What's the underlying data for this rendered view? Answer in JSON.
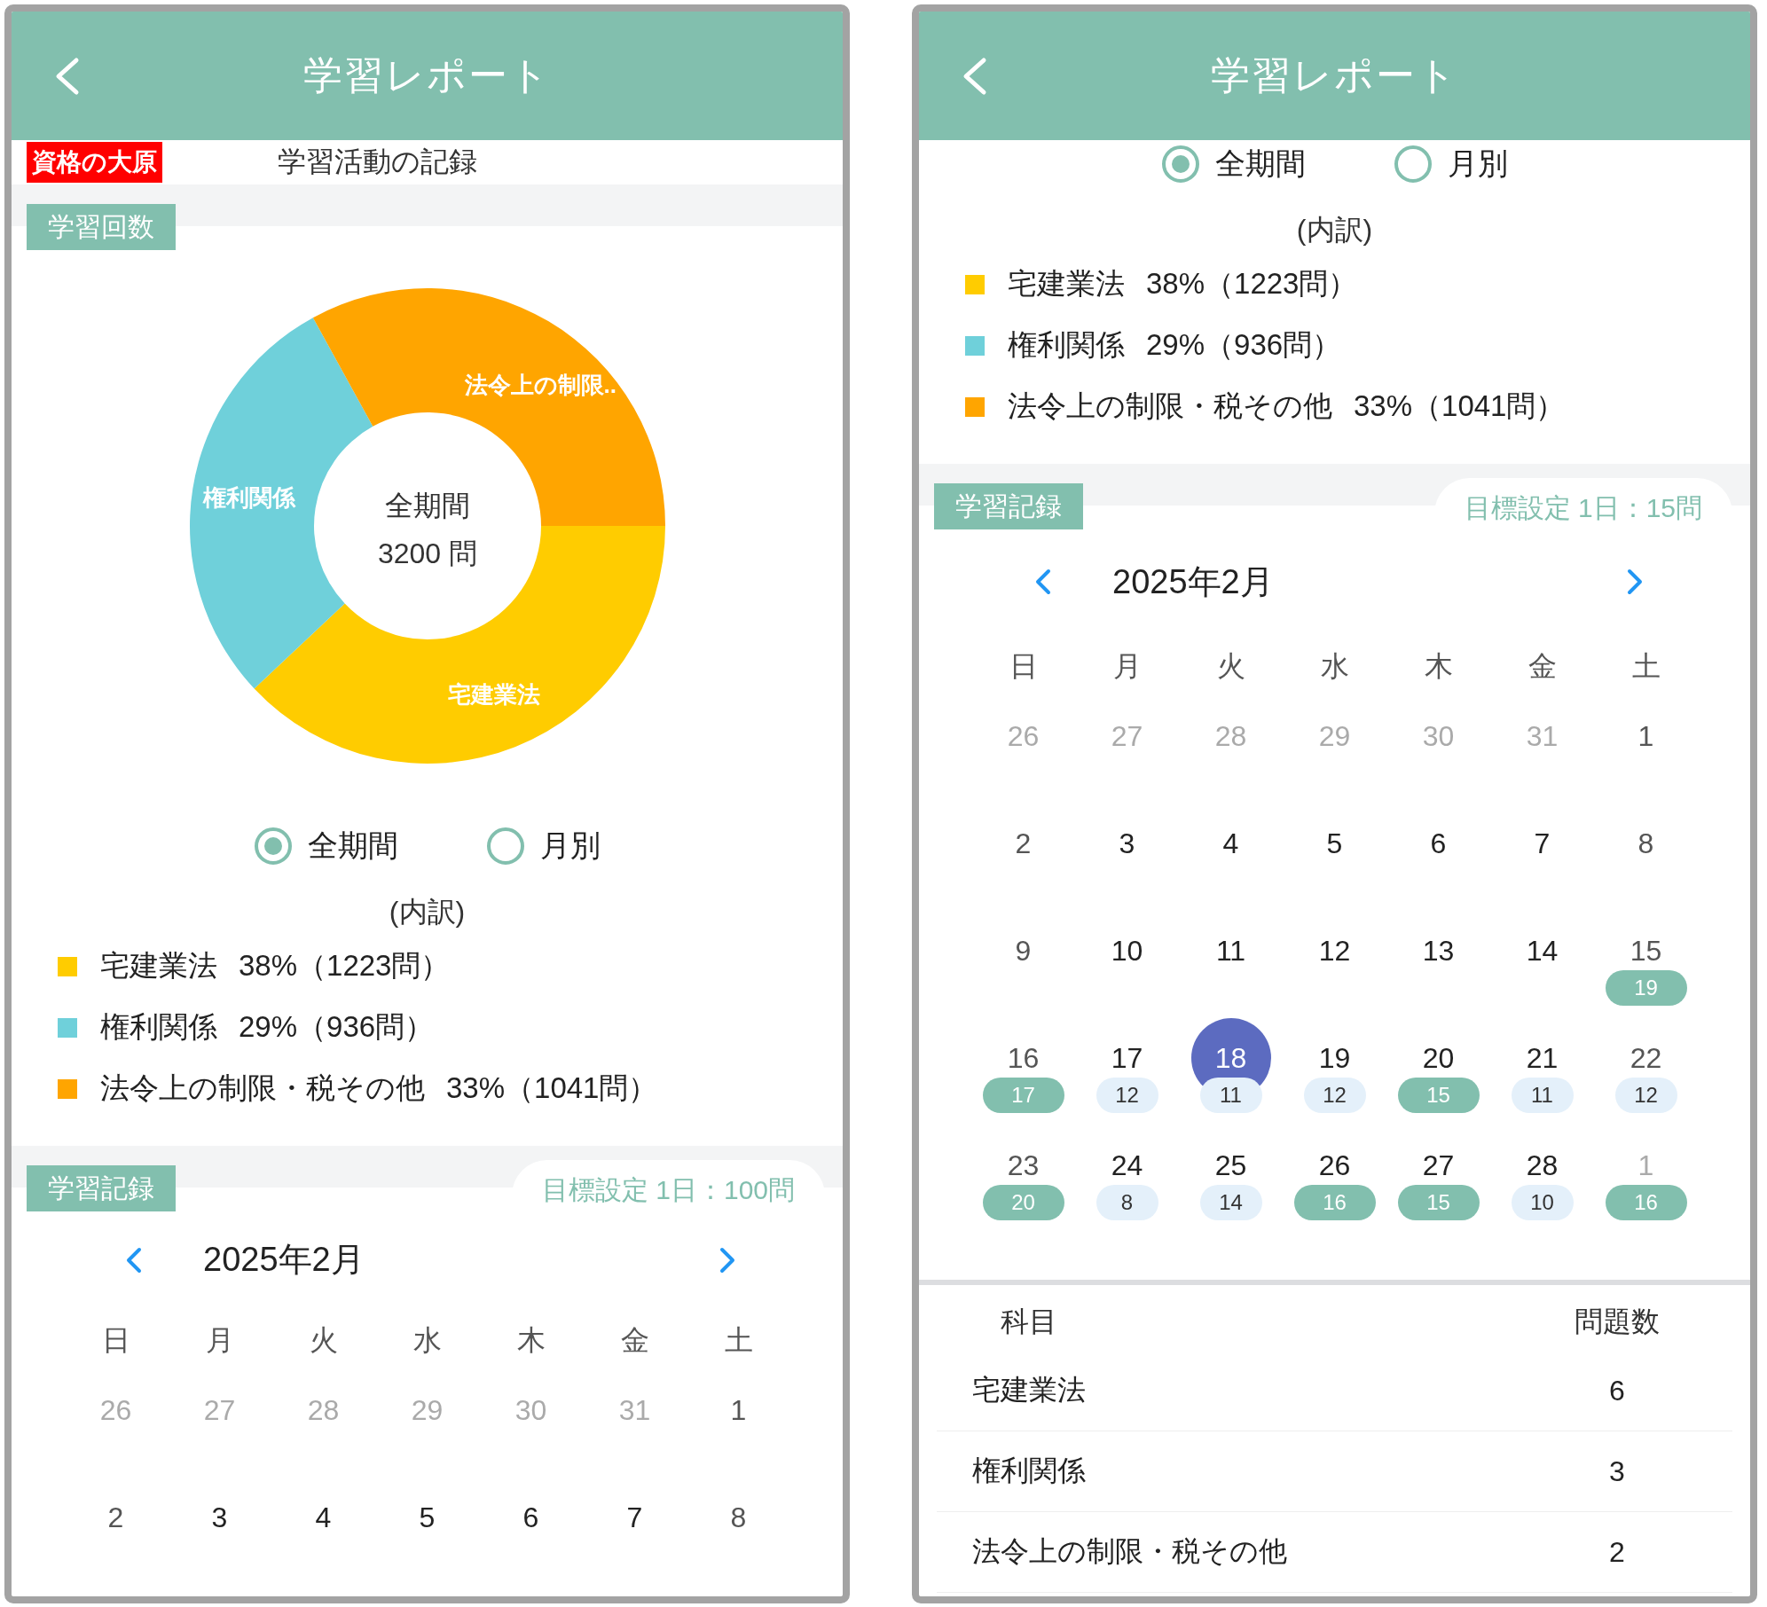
{
  "screens": [
    {
      "header": {
        "title": "学習レポート"
      },
      "subheader": {
        "logo": "資格の大原",
        "title": "学習活動の記録"
      },
      "count_section": {
        "tag": "学習回数",
        "chart_data": {
          "type": "donut",
          "categories": [
            "宅建業法",
            "権利関係",
            "法令上の制限.."
          ],
          "series": [
            {
              "values": [
                38,
                29,
                33
              ]
            }
          ]
        },
        "center": {
          "label": "全期間",
          "total": "3200 問"
        }
      },
      "period_radios": [
        {
          "label": "全期間",
          "selected": true
        },
        {
          "label": "月別",
          "selected": false
        }
      ],
      "breakdown_label": "(内訳)",
      "legend": [
        {
          "name": "宅建業法",
          "value": "38%（1223問）",
          "color": "#ffcc00"
        },
        {
          "name": "権利関係",
          "value": "29%（936問）",
          "color": "#6fd0da"
        },
        {
          "name": "法令上の制限・税その他",
          "value": "33%（1041問）",
          "color": "#ffa500"
        }
      ],
      "record_section": {
        "tag": "学習記録",
        "goal": "目標設定 1日：100問",
        "month": "2025年2月",
        "weekdays": [
          "日",
          "月",
          "火",
          "水",
          "木",
          "金",
          "土"
        ],
        "weeks": [
          [
            {
              "day": "26",
              "muted": true,
              "selected": false
            },
            {
              "day": "27",
              "muted": true,
              "selected": false
            },
            {
              "day": "28",
              "muted": true,
              "selected": false
            },
            {
              "day": "29",
              "muted": true,
              "selected": false
            },
            {
              "day": "30",
              "muted": true,
              "selected": false
            },
            {
              "day": "31",
              "muted": true,
              "selected": false
            },
            {
              "day": "1",
              "muted": false,
              "selected": false
            }
          ],
          [
            {
              "day": "2",
              "muted": false,
              "selected": false
            },
            {
              "day": "3",
              "muted": false,
              "selected": false
            },
            {
              "day": "4",
              "muted": false,
              "selected": false
            },
            {
              "day": "5",
              "muted": false,
              "selected": false
            },
            {
              "day": "6",
              "muted": false,
              "selected": false
            },
            {
              "day": "7",
              "muted": false,
              "selected": false
            },
            {
              "day": "8",
              "muted": false,
              "selected": false
            }
          ]
        ]
      }
    },
    {
      "header": {
        "title": "学習レポート"
      },
      "period_radios": [
        {
          "label": "全期間",
          "selected": true
        },
        {
          "label": "月別",
          "selected": false
        }
      ],
      "breakdown_label": "(内訳)",
      "legend": [
        {
          "name": "宅建業法",
          "value": "38%（1223問）",
          "color": "#ffcc00"
        },
        {
          "name": "権利関係",
          "value": "29%（936問）",
          "color": "#6fd0da"
        },
        {
          "name": "法令上の制限・税その他",
          "value": "33%（1041問）",
          "color": "#ffa500"
        }
      ],
      "record_section": {
        "tag": "学習記録",
        "goal": "目標設定 1日：15問",
        "month": "2025年2月",
        "weekdays": [
          "日",
          "月",
          "火",
          "水",
          "木",
          "金",
          "土"
        ],
        "weeks": [
          [
            {
              "day": "26",
              "muted": true,
              "selected": false
            },
            {
              "day": "27",
              "muted": true,
              "selected": false
            },
            {
              "day": "28",
              "muted": true,
              "selected": false
            },
            {
              "day": "29",
              "muted": true,
              "selected": false
            },
            {
              "day": "30",
              "muted": true,
              "selected": false
            },
            {
              "day": "31",
              "muted": true,
              "selected": false
            },
            {
              "day": "1",
              "muted": false,
              "selected": false
            }
          ],
          [
            {
              "day": "2",
              "muted": false,
              "selected": false
            },
            {
              "day": "3",
              "muted": false,
              "selected": false
            },
            {
              "day": "4",
              "muted": false,
              "selected": false
            },
            {
              "day": "5",
              "muted": false,
              "selected": false
            },
            {
              "day": "6",
              "muted": false,
              "selected": false
            },
            {
              "day": "7",
              "muted": false,
              "selected": false
            },
            {
              "day": "8",
              "muted": false,
              "selected": false
            }
          ],
          [
            {
              "day": "9",
              "muted": false,
              "selected": false
            },
            {
              "day": "10",
              "muted": false,
              "selected": false
            },
            {
              "day": "11",
              "muted": false,
              "selected": false
            },
            {
              "day": "12",
              "muted": false,
              "selected": false
            },
            {
              "day": "13",
              "muted": false,
              "selected": false
            },
            {
              "day": "14",
              "muted": false,
              "selected": false
            },
            {
              "day": "15",
              "muted": false,
              "selected": false,
              "badge": {
                "count": "19",
                "met": true
              }
            }
          ],
          [
            {
              "day": "16",
              "muted": false,
              "selected": false,
              "badge": {
                "count": "17",
                "met": true
              }
            },
            {
              "day": "17",
              "muted": false,
              "selected": false,
              "badge": {
                "count": "12",
                "met": false
              }
            },
            {
              "day": "18",
              "muted": false,
              "selected": true,
              "badge": {
                "count": "11",
                "met": false
              }
            },
            {
              "day": "19",
              "muted": false,
              "selected": false,
              "badge": {
                "count": "12",
                "met": false
              }
            },
            {
              "day": "20",
              "muted": false,
              "selected": false,
              "badge": {
                "count": "15",
                "met": true
              }
            },
            {
              "day": "21",
              "muted": false,
              "selected": false,
              "badge": {
                "count": "11",
                "met": false
              }
            },
            {
              "day": "22",
              "muted": false,
              "selected": false,
              "badge": {
                "count": "12",
                "met": false
              }
            }
          ],
          [
            {
              "day": "23",
              "muted": false,
              "selected": false,
              "badge": {
                "count": "20",
                "met": true
              }
            },
            {
              "day": "24",
              "muted": false,
              "selected": false,
              "badge": {
                "count": "8",
                "met": false
              }
            },
            {
              "day": "25",
              "muted": false,
              "selected": false,
              "badge": {
                "count": "14",
                "met": false
              }
            },
            {
              "day": "26",
              "muted": false,
              "selected": false,
              "badge": {
                "count": "16",
                "met": true
              }
            },
            {
              "day": "27",
              "muted": false,
              "selected": false,
              "badge": {
                "count": "15",
                "met": true
              }
            },
            {
              "day": "28",
              "muted": false,
              "selected": false,
              "badge": {
                "count": "10",
                "met": false
              }
            },
            {
              "day": "1",
              "muted": true,
              "selected": false,
              "badge": {
                "count": "16",
                "met": true
              }
            }
          ]
        ]
      },
      "subject_table": {
        "columns": [
          "科目",
          "問題数"
        ],
        "rows": [
          {
            "subject": "宅建業法",
            "count": "6"
          },
          {
            "subject": "権利関係",
            "count": "3"
          },
          {
            "subject": "法令上の制限・税その他",
            "count": "2"
          }
        ]
      }
    }
  ]
}
